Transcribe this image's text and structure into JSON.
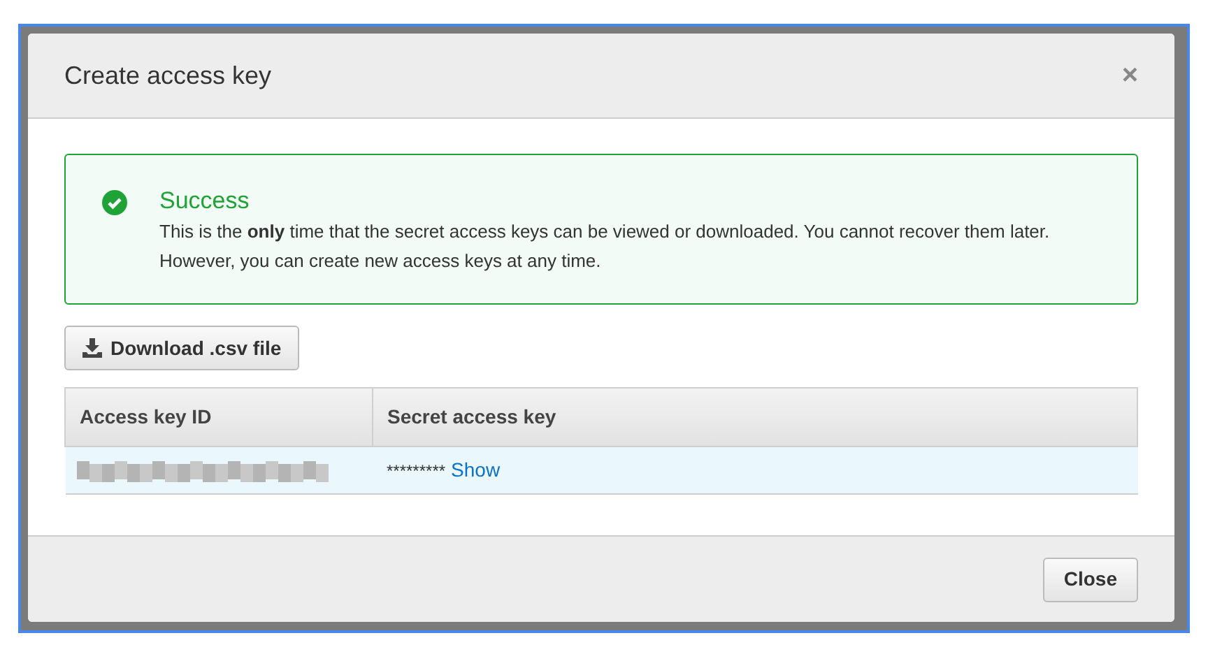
{
  "dialog": {
    "title": "Create access key",
    "close_glyph": "×"
  },
  "alert": {
    "title": "Success",
    "message": "This is the **only** time that the secret access keys can be viewed or downloaded. You cannot recover them later. However, you can create new access keys at any time."
  },
  "download_button": "Download .csv file",
  "table": {
    "columns": [
      "Access key ID",
      "Secret access key"
    ],
    "rows": [
      {
        "secret": "*********",
        "show_link": "Show",
        "selected": true
      }
    ]
  },
  "footer_button": "Close"
}
